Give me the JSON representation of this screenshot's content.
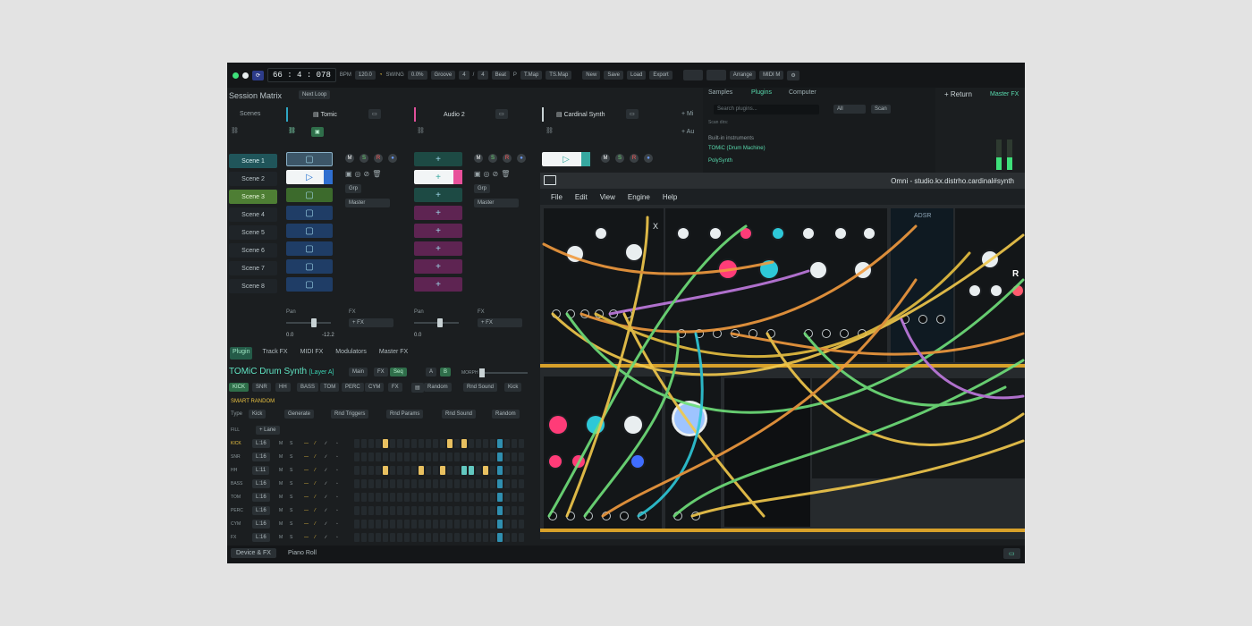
{
  "topbar": {
    "time": "66 : 4 : 078",
    "bpm_label": "BPM",
    "bpm_value": "120.0",
    "swing_label": "SWING",
    "swing_value": "0.0%",
    "groove": "Groove",
    "sig_num": "4",
    "sig_den": "4",
    "quant": "Beat",
    "btn_tmap": "T.Map",
    "btn_tsmap": "TS.Map",
    "btn_new": "New",
    "btn_save": "Save",
    "btn_load": "Load",
    "btn_export": "Export",
    "btn_arrange": "Arrange",
    "btn_midi": "MIDI M"
  },
  "session": {
    "title": "Session Matrix",
    "next_loop": "Next Loop",
    "scenes_header": "Scenes",
    "scenes": [
      "Scene 1",
      "Scene 2",
      "Scene 3",
      "Scene 4",
      "Scene 5",
      "Scene 6",
      "Scene 7",
      "Scene 8"
    ],
    "tracks": [
      "Tomic",
      "Audio 2",
      "Cardinal Synth"
    ],
    "grp_label": "Grp",
    "master_label": "Master",
    "fx_label": "FX",
    "add_fx": "+ FX",
    "pan_label": "Pan",
    "vol_a": "0.0",
    "vol_b": "-12.2",
    "vol_c": "0.0",
    "m_label": "M",
    "s_label": "S",
    "r_label": "R",
    "add_midi": "+ Mi",
    "add_audio": "+ Au"
  },
  "device": {
    "tabs": [
      "Plugin",
      "Track FX",
      "MIDI FX",
      "Modulators",
      "Master FX"
    ],
    "title": "TOMiC Drum Synth",
    "layer": "[Layer A]",
    "sub_tabs": [
      "Main",
      "FX",
      "Seq"
    ],
    "morph_a": "A",
    "morph_b": "B",
    "morph_label": "MORPH",
    "drums": [
      "KICK",
      "SNR",
      "HH",
      "BASS",
      "TOM",
      "PERC",
      "CYM",
      "FX"
    ],
    "random": "Random",
    "rnd_sound": "Rnd Sound",
    "kick_sel": "Kick",
    "smart_random": "SMART RANDOM",
    "type_label": "Type",
    "type_value": "Kick",
    "generate": "Generate",
    "rnd_triggers": "Rnd Triggers",
    "rnd_params": "Rnd Params",
    "rnd_sound2": "Rnd Sound",
    "random2": "Random",
    "fill_label": "FILL",
    "lane_btn": "+ Lane",
    "lanes": [
      {
        "name": "KICK",
        "len": "L:16"
      },
      {
        "name": "SNR",
        "len": "L:16"
      },
      {
        "name": "HH",
        "len": "L:11"
      },
      {
        "name": "BASS",
        "len": "L:16"
      },
      {
        "name": "TOM",
        "len": "L:16"
      },
      {
        "name": "PERC",
        "len": "L:16"
      },
      {
        "name": "CYM",
        "len": "L:16"
      },
      {
        "name": "FX",
        "len": "L:16"
      }
    ]
  },
  "browser": {
    "tabs": [
      "Samples",
      "Plugins",
      "Computer"
    ],
    "search_placeholder": "Search plugins...",
    "filter": "All",
    "scan": "Scan",
    "scan_dirs": "Scan dirs:",
    "builtin": "Built-in instruments",
    "items": [
      "TOMiC (Drum Machine)",
      "PolySynth"
    ],
    "return": "+ Return",
    "master_fx": "Master FX"
  },
  "omni": {
    "title": "Omni - studio.kx.distrho.cardinal#synth",
    "menu": [
      "File",
      "Edit",
      "View",
      "Engine",
      "Help"
    ],
    "mod_adsr": "ADSR",
    "mod_r": "R",
    "mod_x": "X"
  },
  "bottom": {
    "tabs": [
      "Device & FX",
      "Piano Roll"
    ]
  },
  "colors": {
    "accent_teal": "#3ad3b3",
    "clip_blue": "#1f3d66",
    "clip_magenta": "#5e2452",
    "clip_green": "#2f6e4a",
    "cable_yellow": "#f2c94c",
    "cable_green": "#6fe07a",
    "cable_orange": "#f19a3e"
  }
}
